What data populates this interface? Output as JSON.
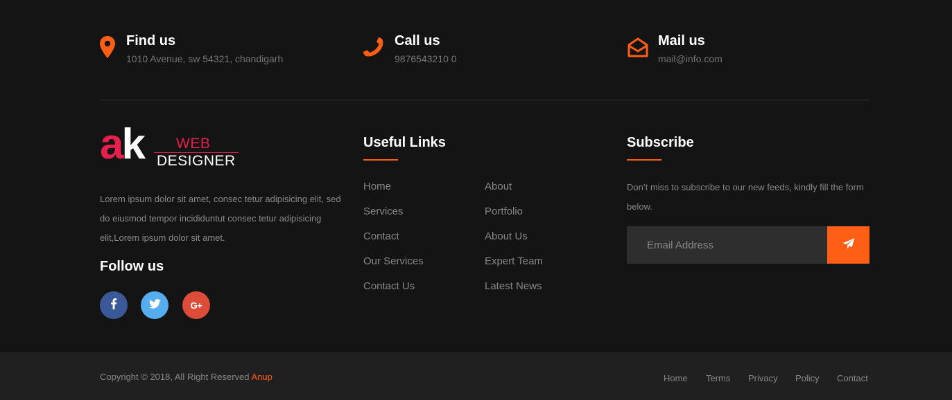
{
  "contact": {
    "find": {
      "title": "Find us",
      "text": "1010 Avenue, sw 54321, chandigarh",
      "icon": "map-marker-icon"
    },
    "call": {
      "title": "Call us",
      "text": "9876543210 0",
      "icon": "phone-icon"
    },
    "mail": {
      "title": "Mail us",
      "text": "mail@info.com",
      "icon": "envelope-open-icon"
    }
  },
  "logo": {
    "mark": "ak",
    "mark_a": "a",
    "mark_k": "k",
    "line1": "WEB",
    "line2": "DESIGNER"
  },
  "about": {
    "text": "Lorem ipsum dolor sit amet, consec tetur adipisicing elit, sed do eiusmod tempor incididuntut consec tetur adipisicing elit,Lorem ipsum dolor sit amet.",
    "follow_title": "Follow us",
    "social": [
      {
        "name": "facebook",
        "glyph": "f",
        "color": "#3b5998"
      },
      {
        "name": "twitter",
        "glyph": "twitter",
        "color": "#55acee"
      },
      {
        "name": "google-plus",
        "glyph": "G+",
        "color": "#dd4b39"
      }
    ]
  },
  "useful_links": {
    "title": "Useful Links",
    "col1": [
      "Home",
      "Services",
      "Contact",
      "Our Services",
      "Contact Us"
    ],
    "col2": [
      "About",
      "Portfolio",
      "About Us",
      "Expert Team",
      "Latest News"
    ]
  },
  "subscribe": {
    "title": "Subscribe",
    "text": "Don’t miss to subscribe to our new feeds, kindly fill the form below.",
    "placeholder": "Email Address",
    "button_icon": "paper-plane-icon"
  },
  "bottom": {
    "copyright": "Copyright © 2018, All Right Reserved",
    "brand": "Anup",
    "links": [
      "Home",
      "Terms",
      "Privacy",
      "Policy",
      "Contact"
    ]
  },
  "colors": {
    "accent": "#ff5e14",
    "background": "#151414",
    "bottom_bar": "#202020",
    "logo_red": "#e5204c"
  }
}
